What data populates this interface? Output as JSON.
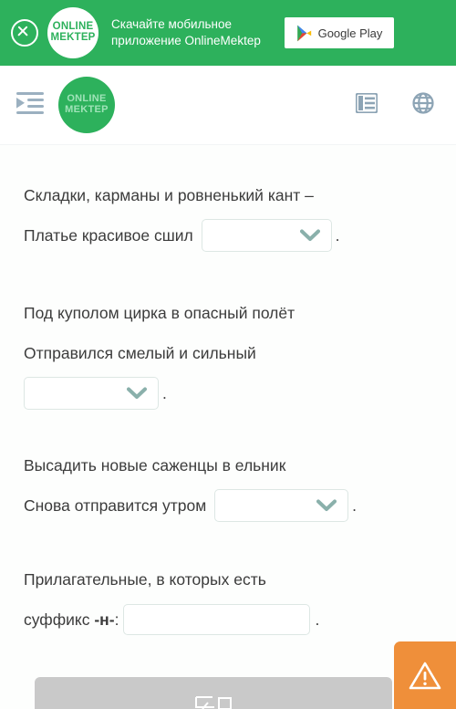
{
  "promo": {
    "close_icon": "close-circle-icon",
    "logo_line1": "ONLINE",
    "logo_line2": "MEKTEP",
    "text_line1": "Скачайте мобильное",
    "text_line2": "приложение OnlineMektep",
    "store_label": "Google Play",
    "store_icon": "google-play-triangle-icon",
    "background_color": "#2db15c"
  },
  "header": {
    "menu_icon": "indent-menu-icon",
    "logo_line1": "ONLINE",
    "logo_line2": "MEKTEP",
    "list_icon": "list-view-icon",
    "globe_icon": "globe-language-icon",
    "logo_color": "#2db15c"
  },
  "questions": [
    {
      "id": "q1",
      "line1": "Складки, карманы и ровненький кант –",
      "line2_before": "Платье красивое сшил ",
      "control": "dropdown",
      "control_value": "",
      "line2_after": "."
    },
    {
      "id": "q2",
      "line1": "Под куполом цирка в опасный полёт",
      "line2_before": "Отправился смелый и сильный",
      "control": "dropdown",
      "control_value": "",
      "line2_after": "."
    },
    {
      "id": "q3",
      "line1": "Высадить новые саженцы в ельник",
      "line2_before": "Снова отправится утром ",
      "control": "dropdown",
      "control_value": "",
      "line2_after": "."
    },
    {
      "id": "q4",
      "line1": "Прилагательные, в которых есть",
      "line2_before": "суффикс ",
      "line2_bold": "-н-",
      "line2_mid": ":",
      "control": "text-input",
      "control_value": "",
      "control_placeholder": "",
      "line2_after": "."
    }
  ],
  "footer": {
    "warn_button_icon": "warning-triangle-icon",
    "warn_button_color": "#ef8f3a",
    "bottom_bar_color": "#c9c9c9",
    "bottom_bar_icon": "feedback-icon"
  },
  "theme": {
    "accent_green": "#2db15c",
    "text_color": "#3c3c3c",
    "field_border": "#dde7e4",
    "chevron_color": "#8ab0ab"
  }
}
